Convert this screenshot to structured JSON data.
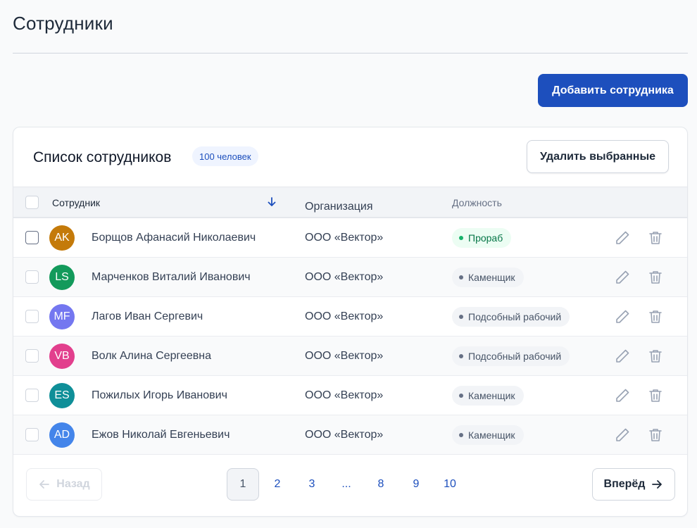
{
  "header": {
    "title": "Сотрудники",
    "add_button_label": "Добавить сотрудника"
  },
  "card": {
    "title": "Список сотрудников",
    "count_badge": "100 человек",
    "delete_selected_label": "Удалить выбранные"
  },
  "table": {
    "columns": {
      "employee": "Сотрудник",
      "organization": "Организация",
      "position": "Должность"
    },
    "rows": [
      {
        "initials": "AK",
        "avatar_color": "#c47a0a",
        "name": "Борщов Афанасий Николаевич",
        "organization": "ООО «Вектор»",
        "position": "Прораб",
        "position_status": "active"
      },
      {
        "initials": "LS",
        "avatar_color": "#139a5b",
        "name": "Марченков Виталий Иванович",
        "organization": "ООО «Вектор»",
        "position": "Каменщик",
        "position_status": "neutral"
      },
      {
        "initials": "MF",
        "avatar_color": "#7477f0",
        "name": "Лагов Иван Сергевич",
        "organization": "ООО «Вектор»",
        "position": "Подсобный рабочий",
        "position_status": "neutral"
      },
      {
        "initials": "VB",
        "avatar_color": "#e23f8d",
        "name": "Волк Алина Сергеевна",
        "organization": "ООО «Вектор»",
        "position": "Подсобный рабочий",
        "position_status": "neutral"
      },
      {
        "initials": "ES",
        "avatar_color": "#0f8f98",
        "name": "Пожилых Игорь Иванович",
        "organization": "ООО «Вектор»",
        "position": "Каменщик",
        "position_status": "neutral"
      },
      {
        "initials": "AD",
        "avatar_color": "#4485ea",
        "name": "Ежов Николай Евгеньевич",
        "organization": "ООО «Вектор»",
        "position": "Каменщик",
        "position_status": "neutral"
      }
    ]
  },
  "pagination": {
    "prev_label": "Назад",
    "next_label": "Вперёд",
    "pages": [
      "1",
      "2",
      "3",
      "...",
      "8",
      "9",
      "10"
    ],
    "current_page": "1"
  },
  "colors": {
    "accent": "#1d4fbd",
    "active_badge_bg": "#ecfdf3",
    "active_badge_text": "#067647"
  }
}
